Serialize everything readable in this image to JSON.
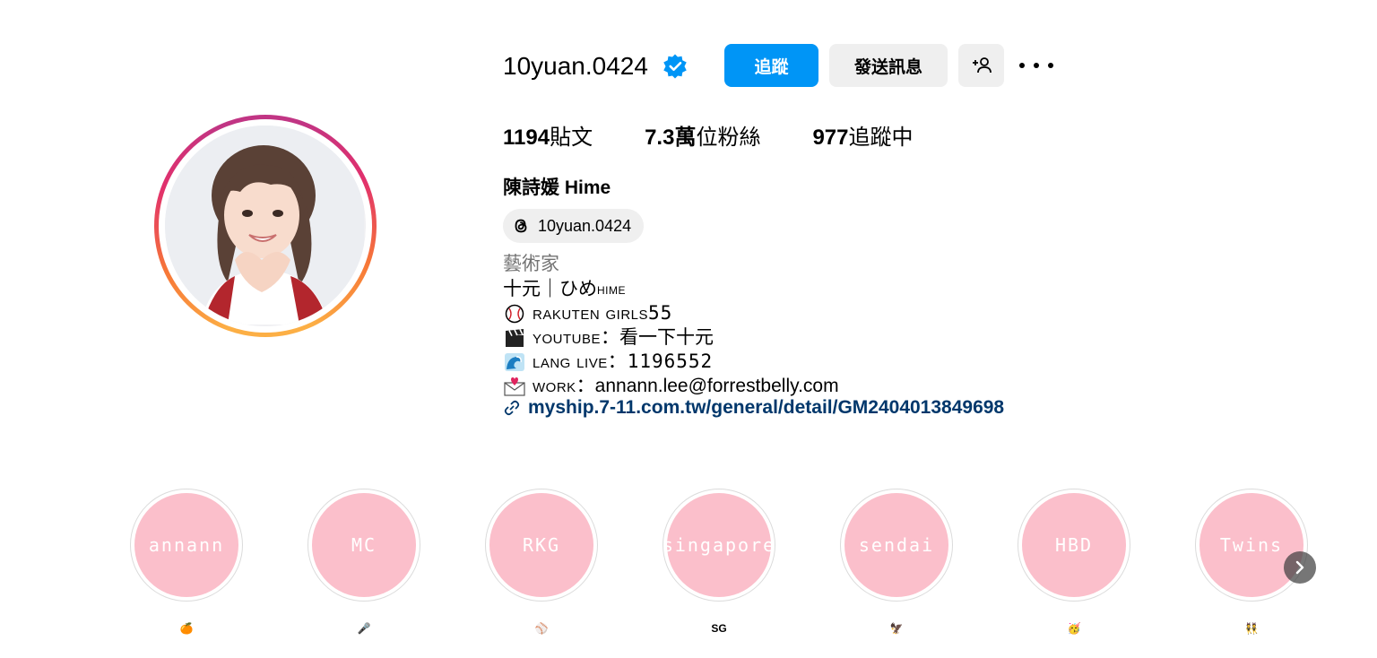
{
  "profile": {
    "username": "10yuan.0424",
    "follow_label": "追蹤",
    "message_label": "發送訊息",
    "stats": {
      "posts_count": "1194",
      "posts_label": "貼文",
      "followers_count": "7.3萬",
      "followers_label": "位粉絲",
      "following_count": "977",
      "following_label": "追蹤中"
    },
    "full_name": "陳詩媛 Hime",
    "threads_handle": "10yuan.0424",
    "category": "藝術家",
    "bio": {
      "line1_a": "十元｜ひめ",
      "line1_b": "hime",
      "line2_a": "rakuten girls",
      "line2_b": " 55",
      "line3_a": "youtube",
      "line3_b": "：看一下十元",
      "line4_a": "lang live",
      "line4_b": "：1196552",
      "line5_a": "work",
      "line5_b": "：annann.lee@forrestbelly.com"
    },
    "link": "myship.7-11.com.tw/general/detail/GM2404013849698"
  },
  "highlights": [
    {
      "cover": "annann",
      "label": "🍊",
      "icon": "orange-icon"
    },
    {
      "cover": "MC",
      "label": "🎤",
      "icon": "microphone-icon"
    },
    {
      "cover": "RKG",
      "label": "⚾",
      "icon": "baseball-icon"
    },
    {
      "cover": "singapore",
      "label": "SG",
      "icon": "sg-flag-text"
    },
    {
      "cover": "sendai",
      "label": "🦅",
      "icon": "eagle-icon"
    },
    {
      "cover": "HBD",
      "label": "🥳",
      "icon": "party-face-icon"
    },
    {
      "cover": "Twins",
      "label": "👯",
      "icon": "twins-icon"
    }
  ],
  "colors": {
    "follow_button": "#0095f6",
    "secondary_button": "#efefef",
    "link": "#00376b",
    "highlight_fill": "#fbbfcb",
    "verified": "#0095f6"
  }
}
